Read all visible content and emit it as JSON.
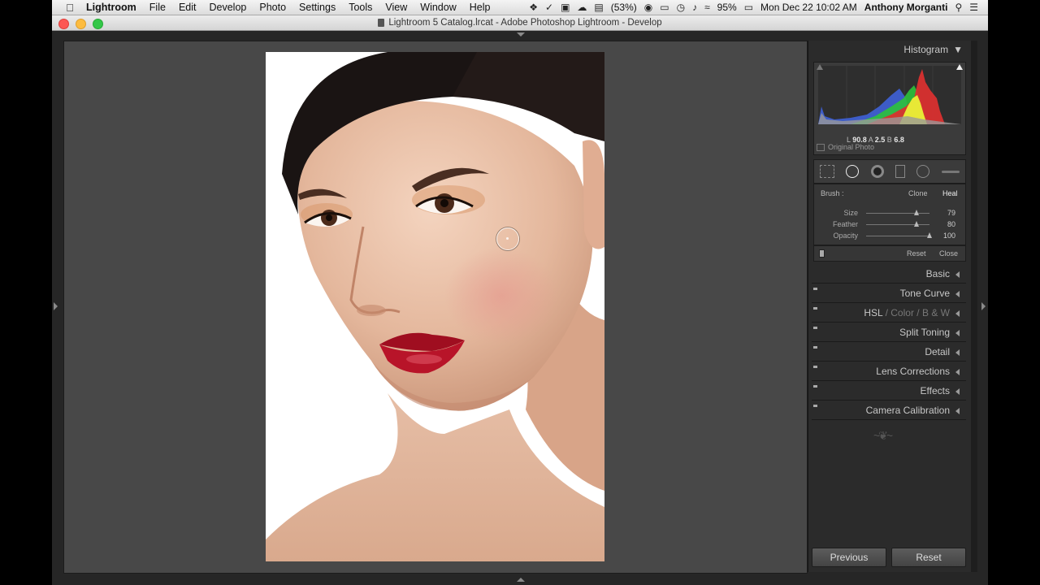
{
  "menubar": {
    "app": "Lightroom",
    "items": [
      "File",
      "Edit",
      "Develop",
      "Photo",
      "Settings",
      "Tools",
      "View",
      "Window",
      "Help"
    ],
    "battery_low": "(53%)",
    "battery": "95%",
    "datetime": "Mon Dec 22  10:02 AM",
    "user": "Anthony Morganti"
  },
  "window": {
    "title": "Lightroom 5 Catalog.lrcat - Adobe Photoshop Lightroom - Develop"
  },
  "histogram": {
    "title": "Histogram",
    "readout": {
      "l_label": "L",
      "l": "90.8",
      "a_label": "A",
      "a": "2.5",
      "b_label": "B",
      "b": "6.8"
    },
    "original_photo": "Original Photo"
  },
  "brush": {
    "label": "Brush :",
    "clone": "Clone",
    "heal": "Heal",
    "size_label": "Size",
    "size": "79",
    "size_level": 0.79,
    "feather_label": "Feather",
    "feather": "80",
    "feather_level": 0.8,
    "opacity_label": "Opacity",
    "opacity": "100",
    "opacity_level": 1.0,
    "reset": "Reset",
    "close": "Close"
  },
  "panels": {
    "basic": "Basic",
    "tone_curve": "Tone Curve",
    "hsl": "HSL",
    "color": "Color",
    "bw": "B & W",
    "slash": "/",
    "split_toning": "Split Toning",
    "detail": "Detail",
    "lens_corrections": "Lens Corrections",
    "effects": "Effects",
    "camera_calibration": "Camera Calibration"
  },
  "buttons": {
    "previous": "Previous",
    "reset": "Reset"
  },
  "colors": {
    "panel_bg": "#2b2b2b",
    "canvas_bg": "#484848",
    "lip": "#b01126"
  }
}
